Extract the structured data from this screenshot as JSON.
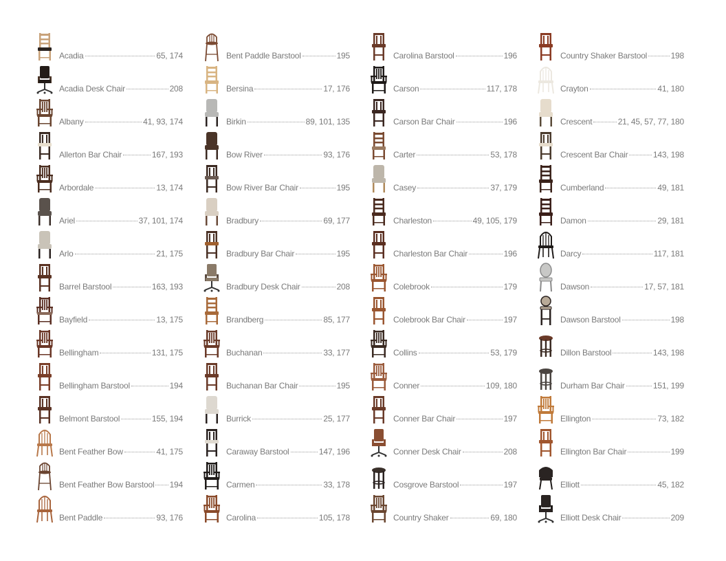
{
  "columns": [
    [
      {
        "name": "Acadia",
        "pages": "65, 174",
        "icon": "side-chair-icon",
        "wood": "#c8a27a",
        "seat": "#2a2320"
      },
      {
        "name": "Acadia Desk Chair",
        "pages": "208",
        "icon": "desk-chair-icon",
        "wood": "#4a3528",
        "seat": "#231c18"
      },
      {
        "name": "Albany",
        "pages": "41, 93, 174",
        "icon": "arm-chair-icon",
        "wood": "#6a4530",
        "seat": "#6a4530"
      },
      {
        "name": "Allerton Bar Chair",
        "pages": "167, 193",
        "icon": "barstool-icon",
        "wood": "#3a2a22",
        "seat": "#e8dfce"
      },
      {
        "name": "Arbordale",
        "pages": "13, 174",
        "icon": "arm-chair-icon",
        "wood": "#4a2c1e",
        "seat": "#4a2c1e"
      },
      {
        "name": "Ariel",
        "pages": "37, 101, 174",
        "icon": "upholstered-chair-icon",
        "wood": "#3a2e28",
        "seat": "#5a524c"
      },
      {
        "name": "Arlo",
        "pages": "21, 175",
        "icon": "upholstered-chair-icon",
        "wood": "#2a2220",
        "seat": "#c9c3b8"
      },
      {
        "name": "Barrel Barstool",
        "pages": "163, 193",
        "icon": "barstool-icon",
        "wood": "#5a3222",
        "seat": "#5a3222"
      },
      {
        "name": "Bayfield",
        "pages": "13, 175",
        "icon": "arm-chair-icon",
        "wood": "#5a2e22",
        "seat": "#8a6a5a"
      },
      {
        "name": "Bellingham",
        "pages": "131, 175",
        "icon": "arm-chair-icon",
        "wood": "#6a3626",
        "seat": "#6a3626"
      },
      {
        "name": "Bellingham Barstool",
        "pages": "194",
        "icon": "barstool-icon",
        "wood": "#7a3e28",
        "seat": "#7a3e28"
      },
      {
        "name": "Belmont Barstool",
        "pages": "155, 194",
        "icon": "barstool-icon",
        "wood": "#5a3224",
        "seat": "#5a3224"
      },
      {
        "name": "Bent Feather Bow",
        "pages": "41, 175",
        "icon": "windsor-chair-icon",
        "wood": "#b8784a",
        "seat": "#b8784a"
      },
      {
        "name": "Bent Feather Bow Barstool",
        "pages": "194",
        "icon": "windsor-barstool-icon",
        "wood": "#6a4430",
        "seat": "#6a4430"
      },
      {
        "name": "Bent Paddle",
        "pages": "93, 176",
        "icon": "windsor-chair-icon",
        "wood": "#a8643c",
        "seat": "#a8643c"
      }
    ],
    [
      {
        "name": "Bent Paddle Barstool",
        "pages": "195",
        "icon": "windsor-barstool-icon",
        "wood": "#7a4a32",
        "seat": "#7a4a32"
      },
      {
        "name": "Bersina",
        "pages": "17, 176",
        "icon": "side-chair-icon",
        "wood": "#d8b482",
        "seat": "#d8b482"
      },
      {
        "name": "Birkin",
        "pages": "89, 101, 135",
        "icon": "upholstered-chair-icon",
        "wood": "#2a2220",
        "seat": "#b8b8b6"
      },
      {
        "name": "Bow River",
        "pages": "93, 176",
        "icon": "upholstered-chair-icon",
        "wood": "#3a2820",
        "seat": "#4a3428"
      },
      {
        "name": "Bow River Bar Chair",
        "pages": "195",
        "icon": "barstool-icon",
        "wood": "#3a2820",
        "seat": "#6a5a52"
      },
      {
        "name": "Bradbury",
        "pages": "69, 177",
        "icon": "upholstered-chair-icon",
        "wood": "#6a4a38",
        "seat": "#d9cfc2"
      },
      {
        "name": "Bradbury Bar Chair",
        "pages": "195",
        "icon": "barstool-icon",
        "wood": "#4a3024",
        "seat": "#a0602e"
      },
      {
        "name": "Bradbury Desk Chair",
        "pages": "208",
        "icon": "desk-chair-icon",
        "wood": "#5a4a40",
        "seat": "#8a7a68"
      },
      {
        "name": "Brandberg",
        "pages": "85, 177",
        "icon": "side-chair-icon",
        "wood": "#a86a3a",
        "seat": "#a86a3a"
      },
      {
        "name": "Buchanan",
        "pages": "33, 177",
        "icon": "arm-chair-icon",
        "wood": "#6a3a28",
        "seat": "#6a3a28"
      },
      {
        "name": "Buchanan Bar Chair",
        "pages": "195",
        "icon": "barstool-icon",
        "wood": "#6a3a28",
        "seat": "#6a3a28"
      },
      {
        "name": "Burrick",
        "pages": "25, 177",
        "icon": "upholstered-chair-icon",
        "wood": "#2a2220",
        "seat": "#ddd8d0"
      },
      {
        "name": "Caraway Barstool",
        "pages": "147, 196",
        "icon": "barstool-icon",
        "wood": "#2a2220",
        "seat": "#e0dad0"
      },
      {
        "name": "Carmen",
        "pages": "33, 178",
        "icon": "arm-chair-icon",
        "wood": "#1e1a18",
        "seat": "#1e1a18"
      },
      {
        "name": "Carolina",
        "pages": "105, 178",
        "icon": "arm-chair-icon",
        "wood": "#8a4a2a",
        "seat": "#8a4a2a"
      }
    ],
    [
      {
        "name": "Carolina Barstool",
        "pages": "196",
        "icon": "barstool-icon",
        "wood": "#6a3a28",
        "seat": "#6a3a28"
      },
      {
        "name": "Carson",
        "pages": "117, 178",
        "icon": "arm-chair-icon",
        "wood": "#1e1a18",
        "seat": "#1e1a18"
      },
      {
        "name": "Carson Bar Chair",
        "pages": "196",
        "icon": "barstool-icon",
        "wood": "#3a2620",
        "seat": "#3a2620"
      },
      {
        "name": "Carter",
        "pages": "53, 178",
        "icon": "side-chair-icon",
        "wood": "#7a4a30",
        "seat": "#9a7a60"
      },
      {
        "name": "Casey",
        "pages": "37, 179",
        "icon": "upholstered-chair-icon",
        "wood": "#b08a5a",
        "seat": "#bdb6aa"
      },
      {
        "name": "Charleston",
        "pages": "49, 105, 179",
        "icon": "side-chair-icon",
        "wood": "#4a2a1e",
        "seat": "#4a2a1e"
      },
      {
        "name": "Charleston Bar Chair",
        "pages": "196",
        "icon": "barstool-icon",
        "wood": "#5a2e20",
        "seat": "#5a2e20"
      },
      {
        "name": "Colebrook",
        "pages": "179",
        "icon": "arm-chair-icon",
        "wood": "#9a5630",
        "seat": "#9a5630"
      },
      {
        "name": "Colebrook Bar Chair",
        "pages": "197",
        "icon": "barstool-icon",
        "wood": "#9a5630",
        "seat": "#9a5630"
      },
      {
        "name": "Collins",
        "pages": "53, 179",
        "icon": "arm-chair-icon",
        "wood": "#3a2a22",
        "seat": "#3a2a22"
      },
      {
        "name": "Conner",
        "pages": "109, 180",
        "icon": "arm-chair-icon",
        "wood": "#9a5a3a",
        "seat": "#9a5a3a"
      },
      {
        "name": "Conner Bar Chair",
        "pages": "197",
        "icon": "barstool-icon",
        "wood": "#6a3a28",
        "seat": "#6a3a28"
      },
      {
        "name": "Conner Desk Chair",
        "pages": "208",
        "icon": "desk-chair-icon",
        "wood": "#8a4e32",
        "seat": "#8a4e32"
      },
      {
        "name": "Cosgrove Barstool",
        "pages": "197",
        "icon": "round-stool-icon",
        "wood": "#2a2220",
        "seat": "#3a302a"
      },
      {
        "name": "Country Shaker",
        "pages": "69, 180",
        "icon": "arm-chair-icon",
        "wood": "#6a4630",
        "seat": "#6a4630"
      }
    ],
    [
      {
        "name": "Country Shaker Barstool",
        "pages": "198",
        "icon": "barstool-icon",
        "wood": "#8a3a22",
        "seat": "#8a3a22"
      },
      {
        "name": "Crayton",
        "pages": "41, 180",
        "icon": "windsor-chair-icon",
        "wood": "#ece8e0",
        "seat": "#ece8e0"
      },
      {
        "name": "Crescent",
        "pages": "21, 45, 57, 77, 180",
        "icon": "upholstered-chair-icon",
        "wood": "#5a4a38",
        "seat": "#e6dccc"
      },
      {
        "name": "Crescent Bar Chair",
        "pages": "143, 198",
        "icon": "barstool-icon",
        "wood": "#4a3a2c",
        "seat": "#e6dccc"
      },
      {
        "name": "Cumberland",
        "pages": "49, 181",
        "icon": "side-chair-icon",
        "wood": "#3a221a",
        "seat": "#3a221a"
      },
      {
        "name": "Damon",
        "pages": "29, 181",
        "icon": "side-chair-icon",
        "wood": "#3a1e18",
        "seat": "#3a1e18"
      },
      {
        "name": "Darcy",
        "pages": "117, 181",
        "icon": "windsor-chair-icon",
        "wood": "#1e1a18",
        "seat": "#1e1a18"
      },
      {
        "name": "Dawson",
        "pages": "17, 57, 181",
        "icon": "oval-back-chair-icon",
        "wood": "#8a8a8a",
        "seat": "#c8c8c6"
      },
      {
        "name": "Dawson Barstool",
        "pages": "198",
        "icon": "oval-barstool-icon",
        "wood": "#2a2220",
        "seat": "#b8aa98"
      },
      {
        "name": "Dillon Barstool",
        "pages": "143, 198",
        "icon": "round-stool-icon",
        "wood": "#3a2a22",
        "seat": "#6a3a28"
      },
      {
        "name": "Durham Bar Chair",
        "pages": "151, 199",
        "icon": "round-stool-icon",
        "wood": "#4a4440",
        "seat": "#4a4440"
      },
      {
        "name": "Ellington",
        "pages": "73, 182",
        "icon": "arm-chair-icon",
        "wood": "#c07a3a",
        "seat": "#c07a3a"
      },
      {
        "name": "Ellington Bar Chair",
        "pages": "199",
        "icon": "barstool-icon",
        "wood": "#a0562e",
        "seat": "#a0562e"
      },
      {
        "name": "Elliott",
        "pages": "45, 182",
        "icon": "captain-chair-icon",
        "wood": "#1e1a18",
        "seat": "#2a2422"
      },
      {
        "name": "Elliott Desk Chair",
        "pages": "209",
        "icon": "desk-chair-icon",
        "wood": "#1e1a18",
        "seat": "#2a2422"
      }
    ]
  ]
}
